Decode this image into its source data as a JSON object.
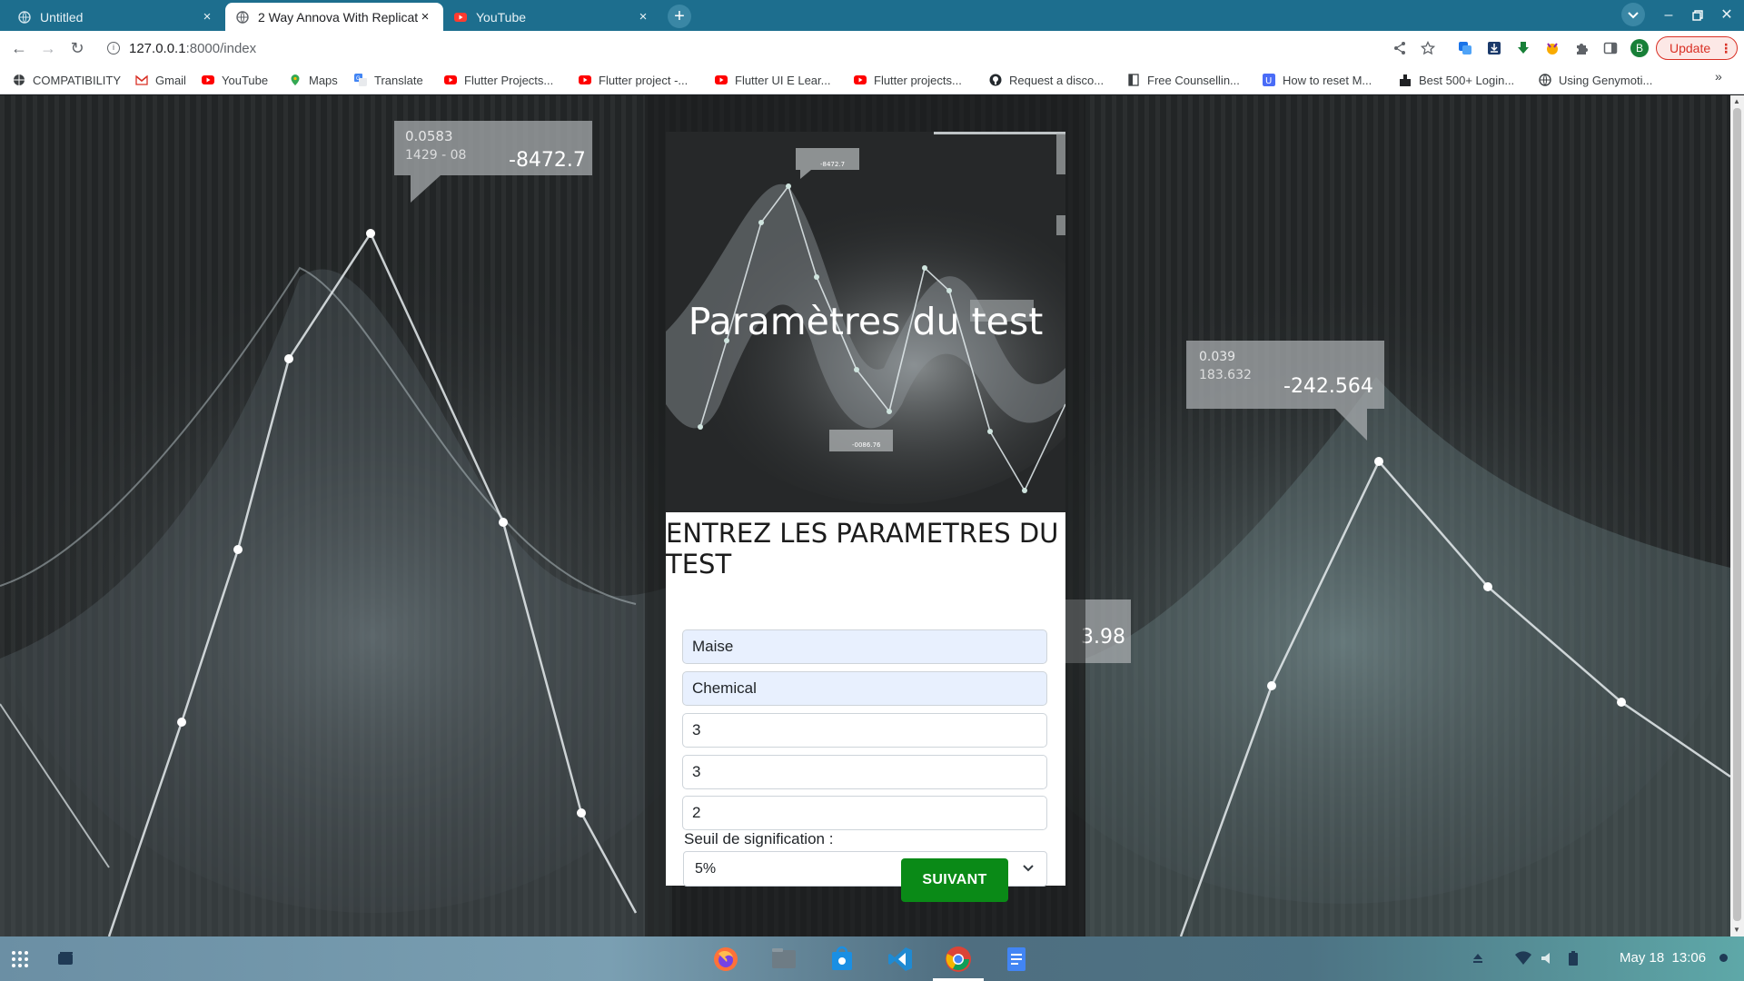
{
  "browser": {
    "tabs": [
      {
        "title": "Untitled",
        "active": false,
        "close": "×"
      },
      {
        "title": "2 Way Annova With Replicat",
        "active": true,
        "close": "×"
      },
      {
        "title": "YouTube",
        "active": false,
        "close": "×"
      }
    ],
    "new_tab": "+",
    "address": {
      "host": "127.0.0.1",
      "path": ":8000/index"
    },
    "update_label": "Update",
    "profile_initial": "B",
    "bookmarks": [
      "COMPATIBILITY",
      "Gmail",
      "YouTube",
      "Maps",
      "Translate",
      "Flutter Projects...",
      "Flutter project -...",
      "Flutter UI E Lear...",
      "Flutter projects...",
      "Request a disco...",
      "Free Counsellin...",
      "How to reset M...",
      "Best 500+ Login...",
      "Using Genymoti..."
    ],
    "bookmarks_more": "»"
  },
  "page": {
    "hero_title": "Paramètres du test",
    "form_heading": "ENTREZ LES PARAMETRES DU TEST",
    "fields": [
      {
        "value": "Maise",
        "autofilled": true
      },
      {
        "value": "Chemical",
        "autofilled": true
      },
      {
        "value": "3",
        "autofilled": false
      },
      {
        "value": "3",
        "autofilled": false
      },
      {
        "value": "2",
        "autofilled": false
      }
    ],
    "seuil_label": "Seuil de signification :",
    "seuil_selected": "5%",
    "submit_label": "SUIVANT",
    "background_readouts": {
      "left_box": [
        "0.0583",
        "1429 - 08",
        "-8472.7"
      ],
      "right_box": [
        "0.039",
        "183.632",
        "-242.564"
      ],
      "partial_value": "3.98"
    },
    "hero_readouts": [
      "-8472.7",
      "-0086.76"
    ]
  },
  "taskbar": {
    "date": "May 18",
    "time": "13:06"
  },
  "colors": {
    "tab_bar": "#1d6e8e",
    "submit_green": "#0a8a17",
    "update_red": "#d93025"
  }
}
